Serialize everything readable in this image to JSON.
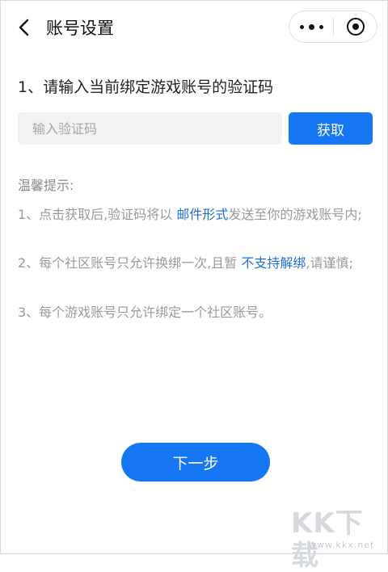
{
  "navbar": {
    "title": "账号设置",
    "back_icon": "chevron-left-icon",
    "more_icon": "more-dots-icon",
    "close_icon": "target-close-icon"
  },
  "step": {
    "heading": "1、请输入当前绑定游戏账号的验证码"
  },
  "code": {
    "value": "",
    "placeholder": "输入验证码",
    "get_label": "获取"
  },
  "tips": {
    "title": "温馨提示:",
    "tip1_before": "1、点击获取后,验证码将以 ",
    "tip1_highlight": "邮件形式",
    "tip1_after": "发送至你的游戏账号内;",
    "tip2_before": "2、每个社区账号只允许换绑一次,且暂 ",
    "tip2_highlight": "不支持解绑",
    "tip2_after": ",请谨慎;",
    "tip3": "3、每个游戏账号只允许绑定一个社区账号。"
  },
  "next_label": "下一步",
  "watermark": {
    "text": "KK下载",
    "url": "www.kkx.net"
  },
  "colors": {
    "accent": "#1677f5",
    "highlight": "#1f6fd6"
  }
}
